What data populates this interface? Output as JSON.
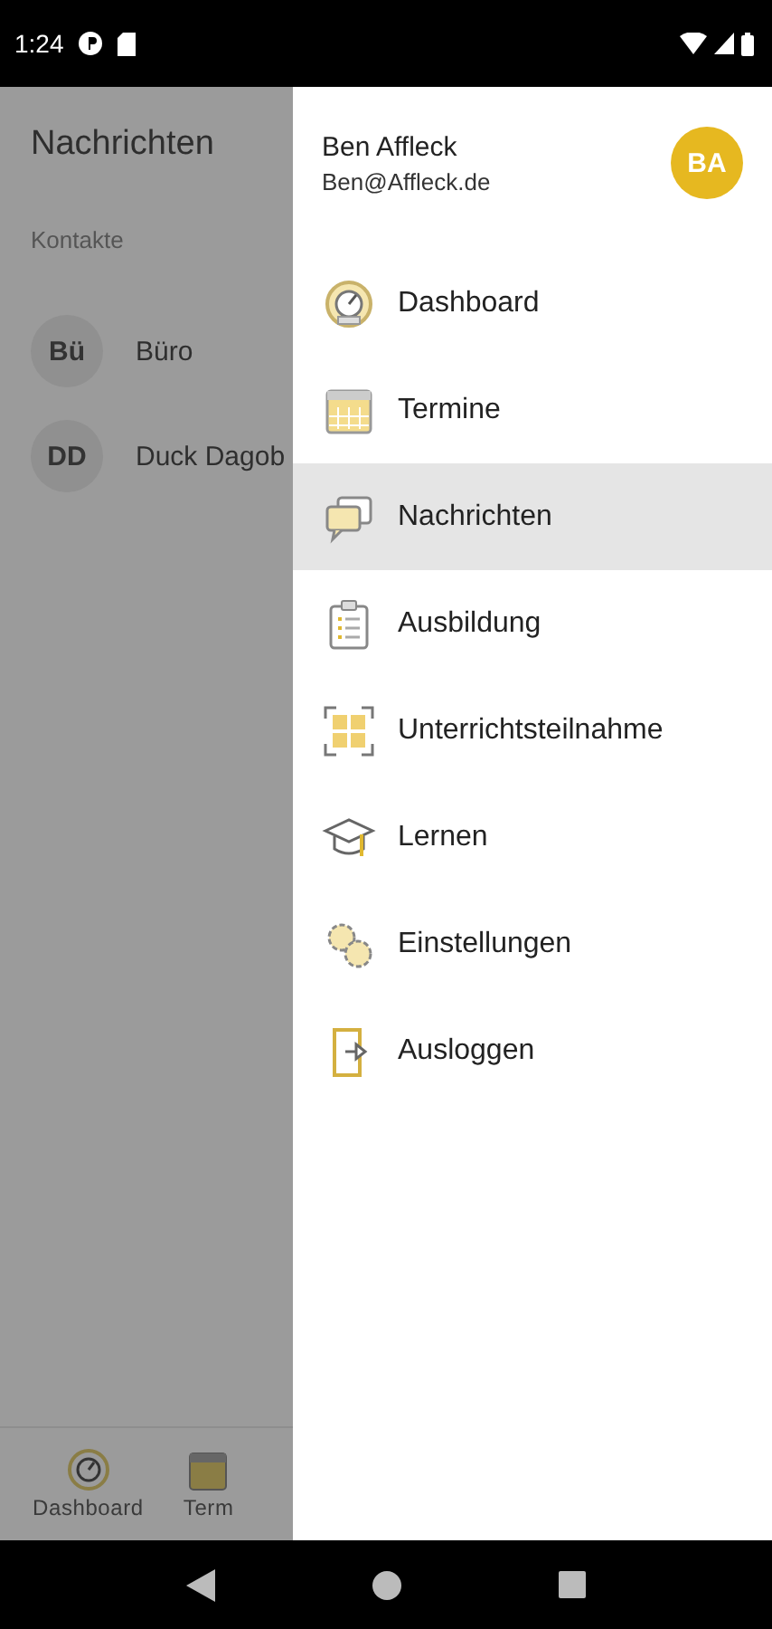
{
  "status_bar": {
    "time": "1:24"
  },
  "background": {
    "title": "Nachrichten",
    "section": "Kontakte",
    "contacts": [
      {
        "initials": "Bü",
        "name": "Büro"
      },
      {
        "initials": "DD",
        "name": "Duck Dagob"
      }
    ],
    "bottom_nav": [
      {
        "label": "Dashboard"
      },
      {
        "label": "Term"
      }
    ]
  },
  "drawer": {
    "user": {
      "name": "Ben Affleck",
      "email": "Ben@Affleck.de",
      "initials": "BA"
    },
    "items": [
      {
        "label": "Dashboard",
        "selected": false
      },
      {
        "label": "Termine",
        "selected": false
      },
      {
        "label": "Nachrichten",
        "selected": true
      },
      {
        "label": "Ausbildung",
        "selected": false
      },
      {
        "label": "Unterrichtsteilnahme",
        "selected": false
      },
      {
        "label": "Lernen",
        "selected": false
      },
      {
        "label": "Einstellungen",
        "selected": false
      },
      {
        "label": "Ausloggen",
        "selected": false
      }
    ]
  }
}
